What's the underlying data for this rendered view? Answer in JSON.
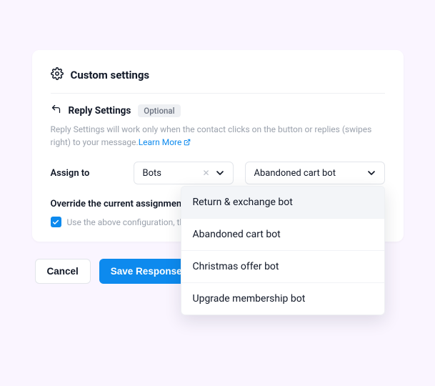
{
  "header": {
    "title": "Custom settings"
  },
  "section": {
    "title": "Reply Settings",
    "badge": "Optional",
    "help_text_a": "Reply Settings will work only when the contact clicks on the button or replies (swipes right) to your message.",
    "learn_more": "Learn More"
  },
  "assign": {
    "label": "Assign to",
    "type_value": "Bots",
    "target_value": "Abandoned cart bot"
  },
  "override": {
    "label": "Override the current assignments?",
    "checkbox_text": "Use the above configuration, though the"
  },
  "dropdown": {
    "items": [
      "Return & exchange bot",
      "Abandoned cart bot",
      "Christmas offer bot",
      "Upgrade membership bot"
    ]
  },
  "actions": {
    "cancel": "Cancel",
    "save": "Save Response"
  }
}
